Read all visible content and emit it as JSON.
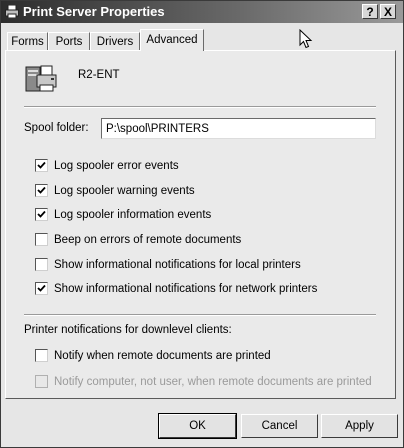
{
  "window": {
    "title": "Print Server Properties",
    "help_label": "?",
    "close_label": "X"
  },
  "tabs": [
    {
      "label": "Forms",
      "active": false
    },
    {
      "label": "Ports",
      "active": false
    },
    {
      "label": "Drivers",
      "active": false
    },
    {
      "label": "Advanced",
      "active": true
    }
  ],
  "server": {
    "name": "R2-ENT",
    "icon": "printer-server-icon"
  },
  "spool": {
    "label": "Spool folder:",
    "value": "P:\\spool\\PRINTERS"
  },
  "options": [
    {
      "label": "Log spooler error events",
      "checked": true
    },
    {
      "label": "Log spooler warning events",
      "checked": true
    },
    {
      "label": "Log spooler information events",
      "checked": true
    },
    {
      "label": "Beep on errors of remote documents",
      "checked": false
    },
    {
      "label": "Show informational notifications for local printers",
      "checked": false
    },
    {
      "label": "Show informational notifications for network printers",
      "checked": true
    }
  ],
  "downlevel": {
    "heading": "Printer notifications for downlevel clients:",
    "options": [
      {
        "label": "Notify when remote documents are printed",
        "checked": false,
        "enabled": true
      },
      {
        "label": "Notify computer, not user, when remote documents are printed",
        "checked": false,
        "enabled": false
      }
    ]
  },
  "buttons": {
    "ok": "OK",
    "cancel": "Cancel",
    "apply": "Apply"
  }
}
